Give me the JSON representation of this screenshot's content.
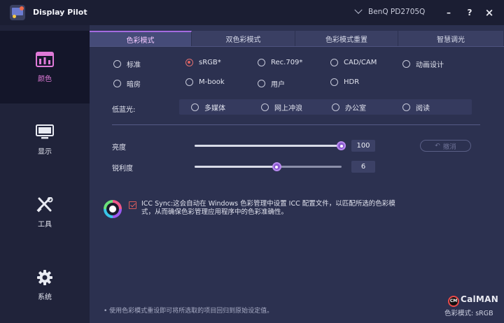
{
  "app": {
    "title": "Display Pilot",
    "monitor": "BenQ PD2705Q",
    "window_buttons": {
      "minimize": "–",
      "help": "?",
      "close": "×"
    }
  },
  "sidebar": {
    "items": [
      {
        "label": "颜色",
        "icon": "color-palette-icon",
        "active": true
      },
      {
        "label": "显示",
        "icon": "monitor-icon",
        "active": false
      },
      {
        "label": "工具",
        "icon": "tools-icon",
        "active": false
      },
      {
        "label": "系统",
        "icon": "gear-icon",
        "active": false
      }
    ]
  },
  "tabs": [
    {
      "label": "色彩模式",
      "active": true
    },
    {
      "label": "双色彩模式",
      "active": false
    },
    {
      "label": "色彩模式重置",
      "active": false
    },
    {
      "label": "智慧调光",
      "active": false
    }
  ],
  "color_modes": {
    "row1": [
      "标准",
      "sRGB*",
      "Rec.709*",
      "CAD/CAM",
      "动画设计"
    ],
    "row2": [
      "暗房",
      "M-book",
      "用户",
      "HDR"
    ],
    "selected": "sRGB*"
  },
  "low_blue_light": {
    "label": "低蓝光:",
    "options": [
      "多媒体",
      "网上冲浪",
      "办公室",
      "阅读"
    ]
  },
  "sliders": {
    "brightness": {
      "label": "亮度",
      "value": "100",
      "fraction": 1.0
    },
    "sharpness": {
      "label": "锐利度",
      "value": "6",
      "fraction": 0.56
    }
  },
  "undo_button": "撤消",
  "icc_sync": {
    "checked": true,
    "text": "ICC Sync:这会自动在 Windows 色彩管理中设置 ICC 配置文件，以匹配所选的色彩模式，从而确保色彩管理应用程序中的色彩准确性。"
  },
  "footnote": "• 使用色彩模式重设即可将所选取的项目回归到原始设定值。",
  "calman": {
    "brand": "CalMAN",
    "badge": "CM"
  },
  "status": {
    "current_mode": "色彩模式: sRGB"
  },
  "colors": {
    "accent": "#a46be0",
    "selected_radio": "#e06060",
    "sidebar_active": "#14162a"
  }
}
